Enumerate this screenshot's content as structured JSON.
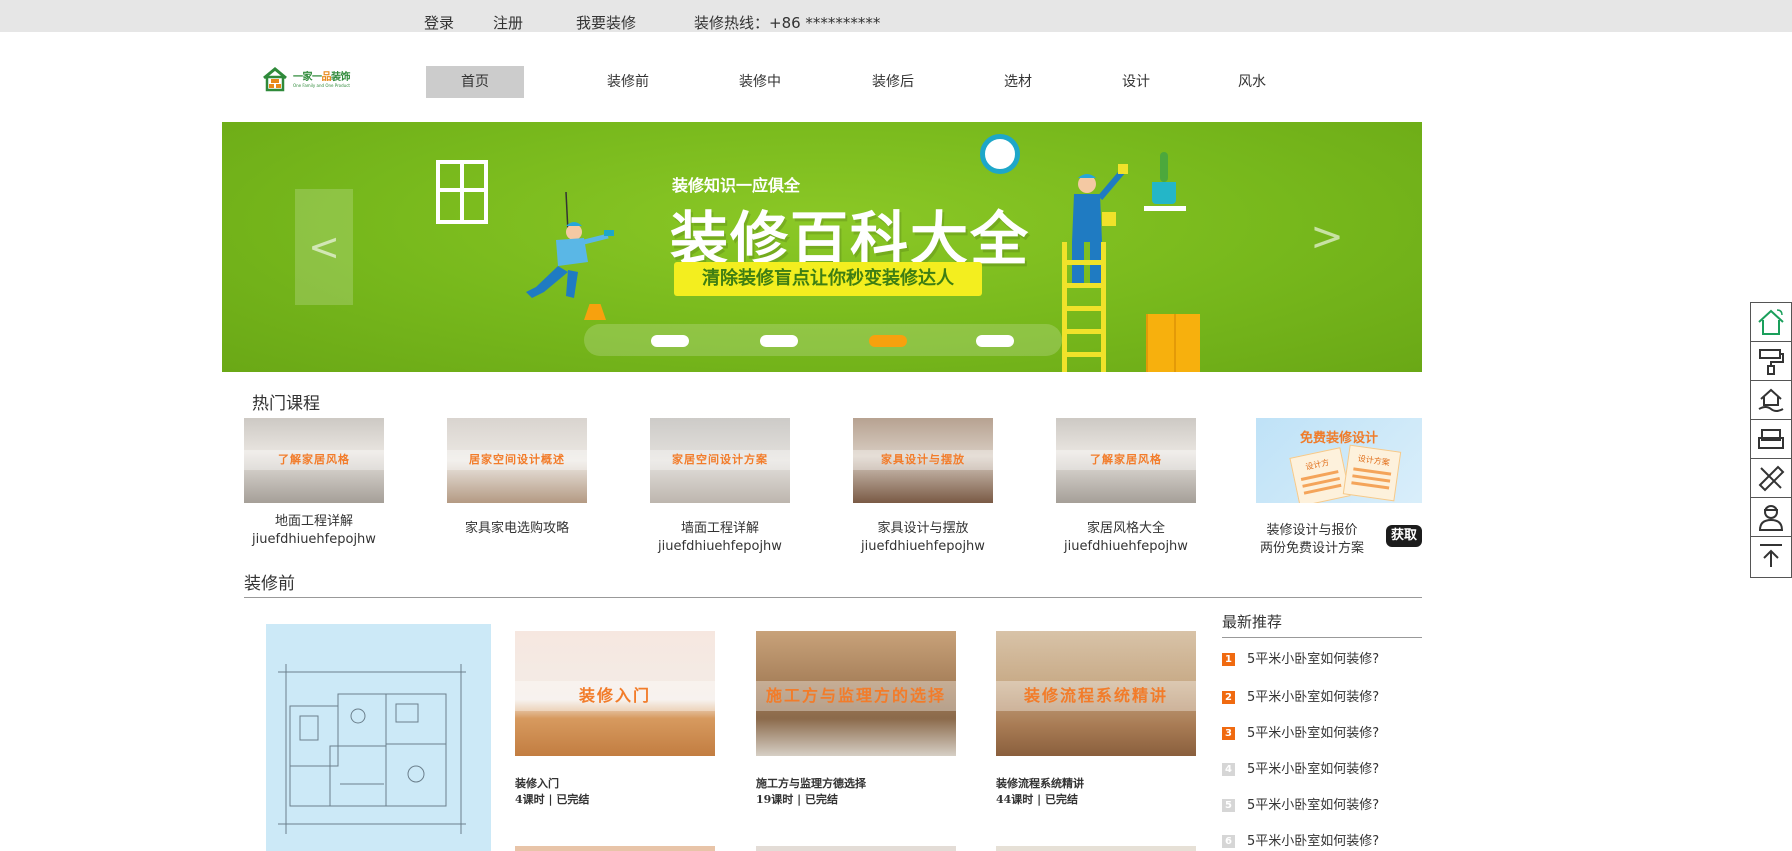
{
  "topbar": {
    "login": "登录",
    "register": "注册",
    "want_renovate": "我要装修",
    "hotline": "装修热线：+86 **********"
  },
  "logo": {
    "name_part1": "一家一",
    "name_part2": "品",
    "name_part3": "装饰",
    "tagline": "One Family and One Product"
  },
  "nav": {
    "items": [
      "首页",
      "装修前",
      "装修中",
      "装修后",
      "选材",
      "设计",
      "风水"
    ],
    "active": "首页"
  },
  "banner": {
    "kicker": "装修知识一应俱全",
    "headline": "装修百科大全",
    "subline": "清除装修盲点让你秒变装修达人",
    "prev": "<",
    "next": ">",
    "active_slide": 3,
    "slide_count": 4
  },
  "hot_courses": {
    "title": "热门课程",
    "items": [
      {
        "thumb": "了解家居风格",
        "title": "地面工程详解",
        "sub": "jiuefdhiuehfepojhw"
      },
      {
        "thumb": "居家空间设计概述",
        "title": "家具家电选购攻略",
        "sub": ""
      },
      {
        "thumb": "家居空间设计方案",
        "title": "墙面工程详解",
        "sub": "jiuefdhiuehfepojhw"
      },
      {
        "thumb": "家具设计与摆放",
        "title": "家具设计与摆放",
        "sub": "jiuefdhiuehfepojhw"
      },
      {
        "thumb": "了解家居风格",
        "title": "家居风格大全",
        "sub": "jiuefdhiuehfepojhw"
      }
    ],
    "free": {
      "thumb_title": "免费装修设计",
      "paper1": "设计方",
      "paper2": "设计方案",
      "line1": "装修设计与报价",
      "line2": "两份免费设计方案",
      "button": "获取"
    }
  },
  "before": {
    "title": "装修前",
    "lessons": [
      {
        "cap": "装修入门",
        "name": "装修入门",
        "meta": "4课时 | 已完结"
      },
      {
        "cap": "施工方与监理方的选择",
        "name": "施工方与监理方德选择",
        "meta": "19课时 | 已完结"
      },
      {
        "cap": "装修流程系统精讲",
        "name": "装修流程系统精讲",
        "meta": "44课时 | 已完结"
      }
    ]
  },
  "latest": {
    "title": "最新推荐",
    "items": [
      {
        "num": "1",
        "text": "5平米小卧室如何装修?"
      },
      {
        "num": "2",
        "text": "5平米小卧室如何装修?"
      },
      {
        "num": "3",
        "text": "5平米小卧室如何装修?"
      },
      {
        "num": "4",
        "text": "5平米小卧室如何装修?"
      },
      {
        "num": "5",
        "text": "5平米小卧室如何装修?"
      },
      {
        "num": "6",
        "text": "5平米小卧室如何装修?"
      }
    ]
  },
  "float_bar": {
    "icons": [
      "home-icon",
      "paint-roller-icon",
      "house-hand-icon",
      "sofa-icon",
      "ruler-pencil-icon",
      "designer-icon",
      "back-to-top-icon"
    ]
  },
  "colors": {
    "accent_orange": "#f06a10",
    "banner_green": "#77b81c",
    "nav_active_bg": "#cccccc",
    "topbar_bg": "#e6e6e6"
  }
}
